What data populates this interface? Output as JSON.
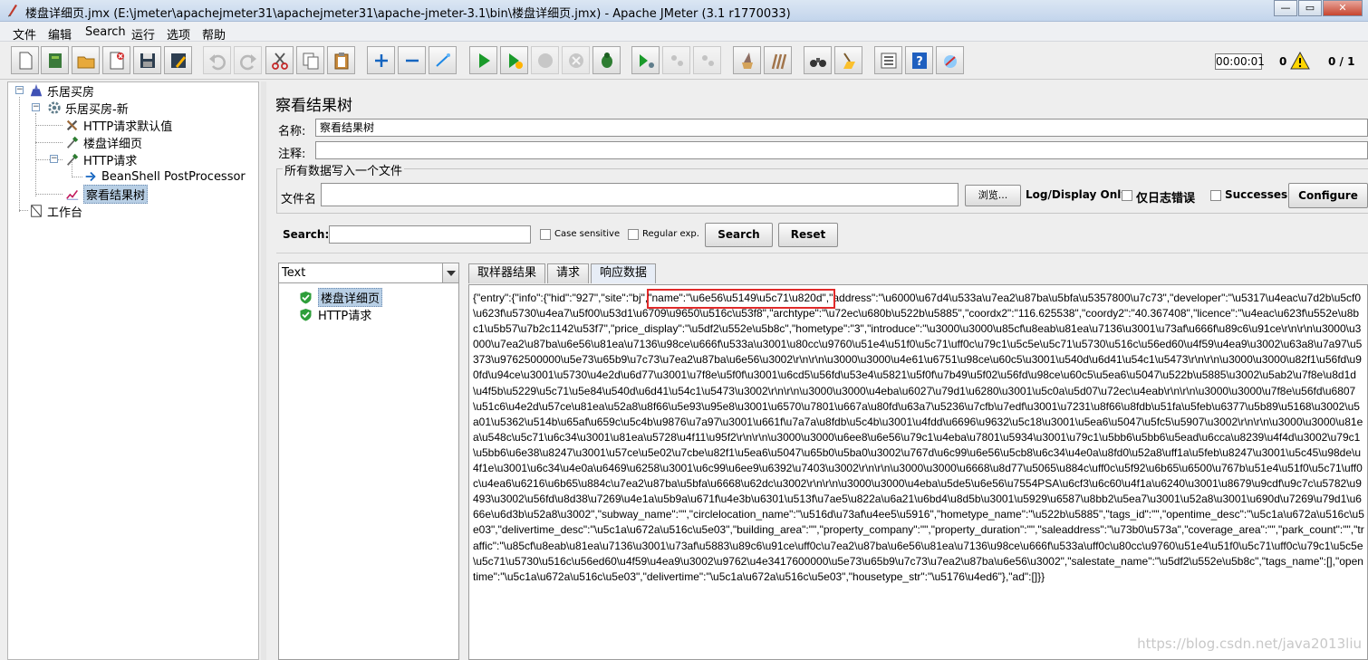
{
  "window": {
    "title": "楼盘详细页.jmx (E:\\jmeter\\apachejmeter31\\apachejmeter31\\apache-jmeter-3.1\\bin\\楼盘详细页.jmx) - Apache JMeter (3.1 r1770033)"
  },
  "menu": [
    "文件",
    "编辑",
    "Search",
    "运行",
    "选项",
    "帮助"
  ],
  "status": {
    "timer": "00:00:01",
    "warnings": "0",
    "threads": "0 / 1"
  },
  "tree": [
    {
      "label": "乐居买房",
      "icon": "test-plan-icon"
    },
    {
      "label": "乐居买房-新",
      "icon": "thread-group-gear-icon"
    },
    {
      "label": "HTTP请求默认值",
      "icon": "config-wrench-icon"
    },
    {
      "label": "楼盘详细页",
      "icon": "sampler-pipette-icon"
    },
    {
      "label": "HTTP请求",
      "icon": "sampler-pipette-icon"
    },
    {
      "label": "BeanShell PostProcessor",
      "icon": "postprocessor-arrow-icon"
    },
    {
      "label": "察看结果树",
      "icon": "listener-chart-icon"
    },
    {
      "label": "工作台",
      "icon": "workbench-icon"
    }
  ],
  "panel": {
    "title": "察看结果树",
    "name_label": "名称:",
    "name_value": "察看结果树",
    "comment_label": "注释:",
    "group_title": "所有数据写入一个文件",
    "file_label": "文件名",
    "browse_label": "浏览...",
    "log_display_label": "Log/Display Only:",
    "errors_only_label": "仅日志错误",
    "successes_label": "Successes",
    "configure_label": "Configure"
  },
  "search": {
    "label": "Search:",
    "case_sensitive": "Case sensitive",
    "regular_exp": "Regular exp.",
    "search_button": "Search",
    "reset_button": "Reset"
  },
  "results": {
    "renderer": "Text",
    "samples": [
      "楼盘详细页",
      "HTTP请求"
    ],
    "tabs": [
      "取样器结果",
      "请求",
      "响应数据"
    ],
    "response_prefix": "{\"entry\":{\"info\":{\"hid\":\"927\",\"site\":\"bj\",",
    "response_highlight": "\"name\":\"\\u6e56\\u5149\\u5c71\\u820d\",",
    "response_rest": "\"address\":\"\\u6000\\u67d4\\u533a\\u7ea2\\u87ba\\u5bfa\\u5357800\\u7c73\",\"developer\":\"\\u5317\\u4eac\\u7d2b\\u5cf0\\u623f\\u5730\\u4ea7\\u5f00\\u53d1\\u6709\\u9650\\u516c\\u53f8\",\"archtype\":\"\\u72ec\\u680b\\u522b\\u5885\",\"coordx2\":\"116.625538\",\"coordy2\":\"40.367408\",\"licence\":\"\\u4eac\\u623f\\u552e\\u8bc1\\u5b57\\u7b2c1142\\u53f7\",\"price_display\":\"\\u5df2\\u552e\\u5b8c\",\"hometype\":\"3\",\"introduce\":\"\\u3000\\u3000\\u85cf\\u8eab\\u81ea\\u7136\\u3001\\u73af\\u666f\\u89c6\\u91ce\\r\\n\\r\\n\\u3000\\u3000\\u7ea2\\u87ba\\u6e56\\u81ea\\u7136\\u98ce\\u666f\\u533a\\u3001\\u80cc\\u9760\\u51e4\\u51f0\\u5c71\\uff0c\\u79c1\\u5c5e\\u5c71\\u5730\\u516c\\u56ed60\\u4f59\\u4ea9\\u3002\\u63a8\\u7a97\\u5373\\u9762500000\\u5e73\\u65b9\\u7c73\\u7ea2\\u87ba\\u6e56\\u3002\\r\\n\\r\\n\\u3000\\u3000\\u4e61\\u6751\\u98ce\\u60c5\\u3001\\u540d\\u6d41\\u54c1\\u5473\\r\\n\\r\\n\\u3000\\u3000\\u82f1\\u56fd\\u90fd\\u94ce\\u3001\\u5730\\u4e2d\\u6d77\\u3001\\u7f8e\\u5f0f\\u3001\\u6cd5\\u56fd\\u53e4\\u5821\\u5f0f\\u7b49\\u5f02\\u56fd\\u98ce\\u60c5\\u5ea6\\u5047\\u522b\\u5885\\u3002\\u5ab2\\u7f8e\\u8d1d\\u4f5b\\u5229\\u5c71\\u5e84\\u540d\\u6d41\\u54c1\\u5473\\u3002\\r\\n\\r\\n\\u3000\\u3000\\u4eba\\u6027\\u79d1\\u6280\\u3001\\u5c0a\\u5d07\\u72ec\\u4eab\\r\\n\\r\\n\\u3000\\u3000\\u7f8e\\u56fd\\u6807\\u51c6\\u4e2d\\u57ce\\u81ea\\u52a8\\u8f66\\u5e93\\u95e8\\u3001\\u6570\\u7801\\u667a\\u80fd\\u63a7\\u5236\\u7cfb\\u7edf\\u3001\\u7231\\u8f66\\u8fdb\\u51fa\\u5feb\\u6377\\u5b89\\u5168\\u3002\\u5a01\\u5362\\u514b\\u65af\\u659c\\u5c4b\\u9876\\u7a97\\u3001\\u661f\\u7a7a\\u8fdb\\u5c4b\\u3001\\u4fdd\\u6696\\u9632\\u5c18\\u3001\\u5ea6\\u5047\\u5fc5\\u5907\\u3002\\r\\n\\r\\n\\u3000\\u3000\\u81ea\\u548c\\u5c71\\u6c34\\u3001\\u81ea\\u5728\\u4f11\\u95f2\\r\\n\\r\\n\\u3000\\u3000\\u6ee8\\u6e56\\u79c1\\u4eba\\u7801\\u5934\\u3001\\u79c1\\u5bb6\\u5bb6\\u5ead\\u6cca\\u8239\\u4f4d\\u3002\\u79c1\\u5bb6\\u6e38\\u8247\\u3001\\u57ce\\u5e02\\u7cbe\\u82f1\\u5ea6\\u5047\\u65b0\\u5ba0\\u3002\\u767d\\u6c99\\u6e56\\u5cb8\\u6c34\\u4e0a\\u8fd0\\u52a8\\uff1a\\u5feb\\u8247\\u3001\\u5c45\\u98de\\u4f1e\\u3001\\u6c34\\u4e0a\\u6469\\u6258\\u3001\\u6c99\\u6ee9\\u6392\\u7403\\u3002\\r\\n\\r\\n\\u3000\\u3000\\u6668\\u8d77\\u5065\\u884c\\uff0c\\u5f92\\u6b65\\u6500\\u767b\\u51e4\\u51f0\\u5c71\\uff0c\\u4ea6\\u6216\\u6b65\\u884c\\u7ea2\\u87ba\\u5bfa\\u6668\\u62dc\\u3002\\r\\n\\r\\n\\u3000\\u3000\\u4eba\\u5de5\\u6e56\\u7554PSA\\u6cf3\\u6c60\\u4f1a\\u6240\\u3001\\u8679\\u9cdf\\u9c7c\\u5782\\u9493\\u3002\\u56fd\\u8d38\\u7269\\u4e1a\\u5b9a\\u671f\\u4e3b\\u6301\\u513f\\u7ae5\\u822a\\u6a21\\u6bd4\\u8d5b\\u3001\\u5929\\u6587\\u8bb2\\u5ea7\\u3001\\u52a8\\u3001\\u690d\\u7269\\u79d1\\u666e\\u6d3b\\u52a8\\u3002\",\"subway_name\":\"\",\"circlelocation_name\":\"\\u516d\\u73af\\u4ee5\\u5916\",\"hometype_name\":\"\\u522b\\u5885\",\"tags_id\":\"\",\"opentime_desc\":\"\\u5c1a\\u672a\\u516c\\u5e03\",\"delivertime_desc\":\"\\u5c1a\\u672a\\u516c\\u5e03\",\"building_area\":\"\",\"property_company\":\"\",\"property_duration\":\"\",\"saleaddress\":\"\\u73b0\\u573a\",\"coverage_area\":\"\",\"park_count\":\"\",\"traffic\":\"\\u85cf\\u8eab\\u81ea\\u7136\\u3001\\u73af\\u5883\\u89c6\\u91ce\\uff0c\\u7ea2\\u87ba\\u6e56\\u81ea\\u7136\\u98ce\\u666f\\u533a\\uff0c\\u80cc\\u9760\\u51e4\\u51f0\\u5c71\\uff0c\\u79c1\\u5c5e\\u5c71\\u5730\\u516c\\u56ed60\\u4f59\\u4ea9\\u3002\\u9762\\u4e3417600000\\u5e73\\u65b9\\u7c73\\u7ea2\\u87ba\\u6e56\\u3002\",\"salestate_name\":\"\\u5df2\\u552e\\u5b8c\",\"tags_name\":[],\"opentime\":\"\\u5c1a\\u672a\\u516c\\u5e03\",\"delivertime\":\"\\u5c1a\\u672a\\u516c\\u5e03\",\"housetype_str\":\"\\u5176\\u4ed6\"},\"ad\":[]}}"
  },
  "watermark": "https://blog.csdn.net/java2013liu",
  "colors": {
    "selection": "#b8cfe5",
    "highlight_border": "#e12a2a",
    "play_green": "#1a9a2a"
  }
}
